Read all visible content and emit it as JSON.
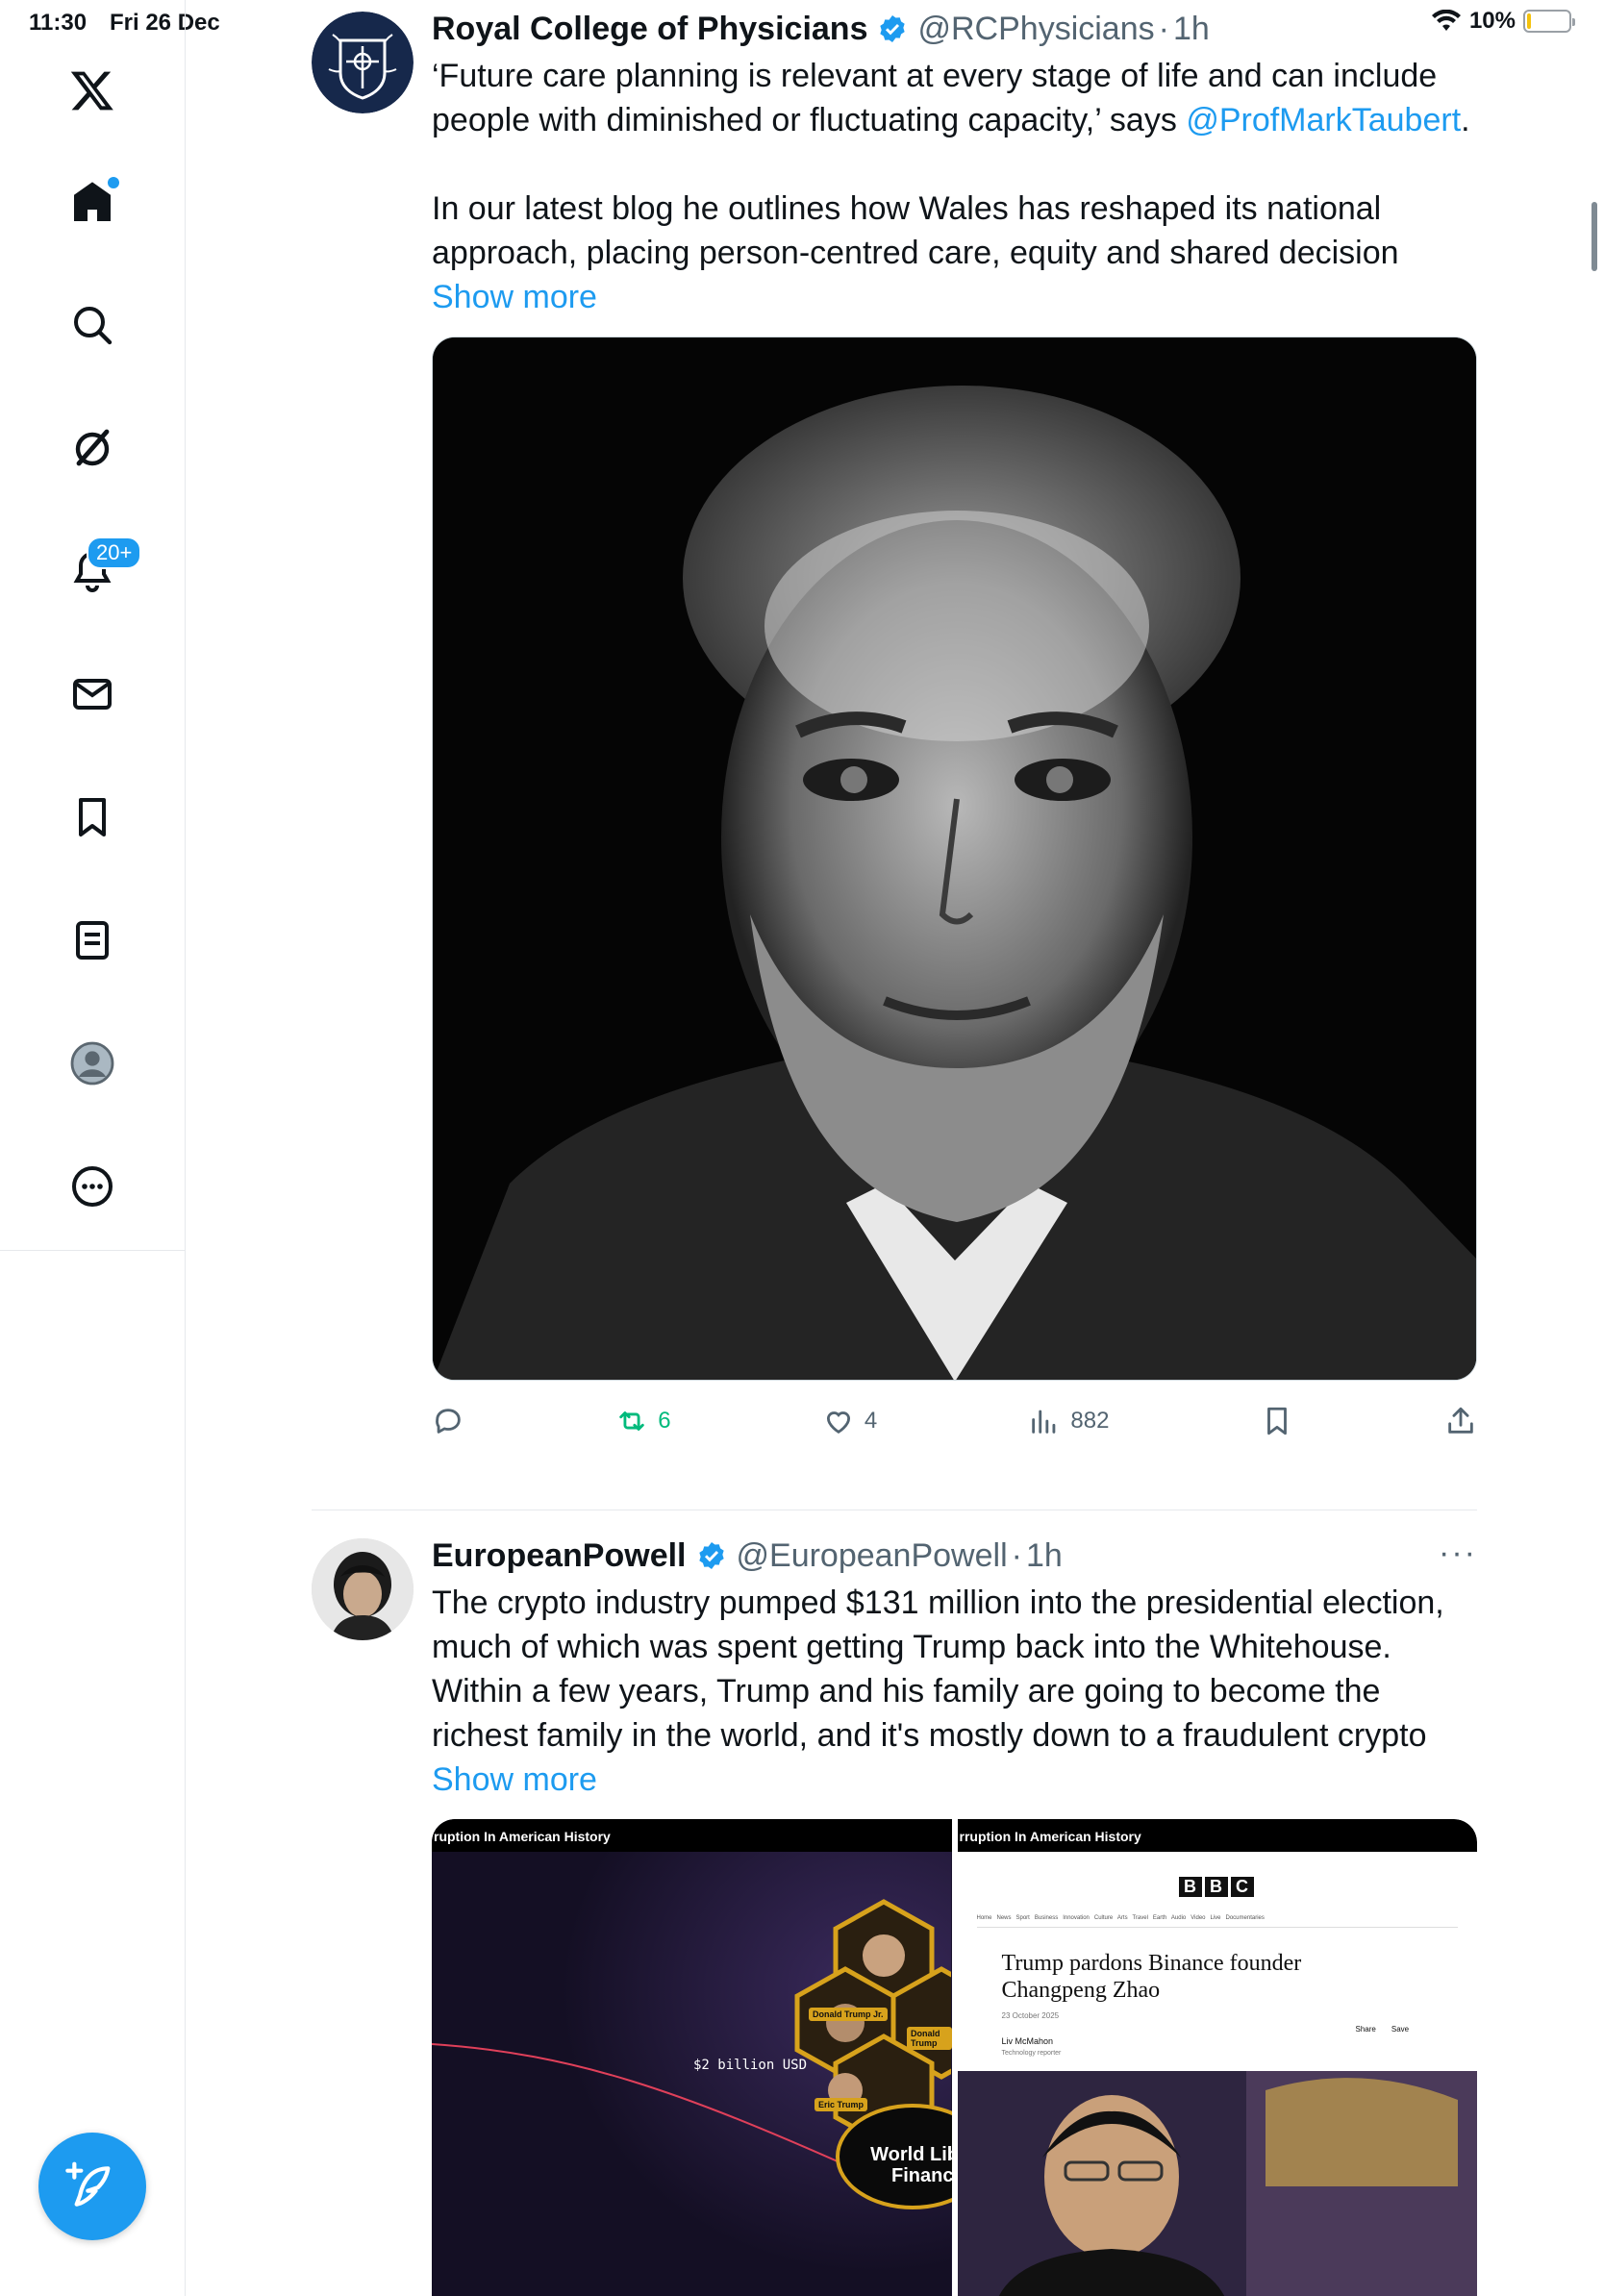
{
  "status_bar": {
    "time": "11:30",
    "date": "Fri 26 Dec",
    "battery_text": "10%",
    "battery_level": 0.1
  },
  "sidebar": {
    "items": [
      {
        "name": "x-logo"
      },
      {
        "name": "home"
      },
      {
        "name": "explore"
      },
      {
        "name": "grok"
      },
      {
        "name": "notifications",
        "badge": "20+"
      },
      {
        "name": "messages"
      },
      {
        "name": "bookmarks"
      },
      {
        "name": "lists"
      },
      {
        "name": "profile"
      },
      {
        "name": "more"
      }
    ]
  },
  "tweets": [
    {
      "name": "Royal College of Physicians",
      "handle": "@RCPhysicians",
      "separator": "·",
      "time": "1h",
      "text_1": "‘Future care planning is relevant at every stage of life and can include people with diminished or fluctuating capacity,’ says",
      "mention": "@ProfMarkTaubert",
      "text_2": ".",
      "text_3": "In our latest blog he outlines how Wales has reshaped its national approach, placing person-centred care, equity and shared decision",
      "show_more": "Show more",
      "retweets": "6",
      "likes": "4",
      "views": "882"
    },
    {
      "name": "EuropeanPowell",
      "handle": "@EuropeanPowell",
      "separator": "·",
      "time": "1h",
      "more": "···",
      "text_1": "The crypto industry pumped $131 million into the presidential election, much of which was spent getting Trump back into the Whitehouse. Within a few years, Trump and his family are going to become the richest family in the world, and it's mostly down to a fraudulent crypto",
      "show_more": "Show more",
      "media_left": {
        "banner": "ruption In American History",
        "amount": "$2 billion USD",
        "badge_1": "Donald Trump Jr.",
        "badge_2": "Donald Trump",
        "badge_3": "Eric Trump",
        "brand": "World Lib Financi"
      },
      "media_right": {
        "banner": "rruption In American History",
        "bbc": [
          "B",
          "B",
          "C"
        ],
        "nav": "Home   News   Sport   Business   Innovation   Culture   Arts   Travel   Earth   Audio   Video   Live   Documentaries",
        "headline": "Trump pardons Binance founder Changpeng Zhao",
        "date": "23 October 2025",
        "author": "Liv McMahon",
        "author_role": "Technology reporter",
        "share": "Share",
        "save": "Save"
      }
    }
  ]
}
